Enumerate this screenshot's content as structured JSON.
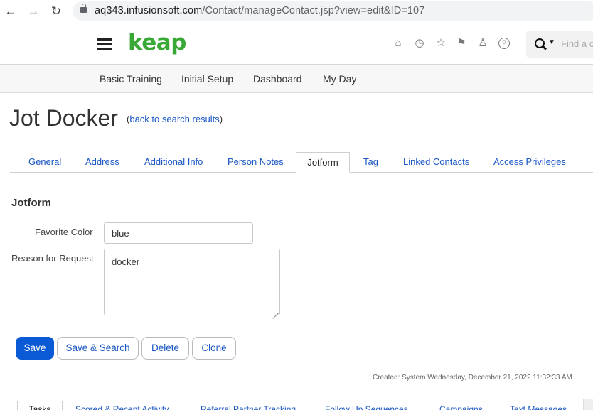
{
  "browser": {
    "back_icon": "←",
    "forward_icon": "→",
    "reload_icon": "↻",
    "url_host": "aq343.infusionsoft.com",
    "url_path": "/Contact/manageContact.jsp?view=edit&ID=107"
  },
  "header": {
    "logo_text": "keap",
    "logo_color": "#39a935",
    "icons": [
      "home-icon",
      "history-icon",
      "star-icon",
      "flag-icon",
      "user-icon",
      "help-icon"
    ],
    "icon_glyphs": [
      "⌂",
      "◷",
      "☆",
      "⚑",
      "♙",
      "?"
    ],
    "search_caret": "▼",
    "search_placeholder": "Find a c"
  },
  "sub_nav": {
    "items": [
      "Basic Training",
      "Initial Setup",
      "Dashboard",
      "My Day"
    ]
  },
  "page": {
    "title": "Jot Docker",
    "back_open": "(",
    "back_link": "back to search results",
    "back_close": ")"
  },
  "tabs": {
    "items": [
      "General",
      "Address",
      "Additional Info",
      "Person Notes",
      "Jotform",
      "Tag",
      "Linked Contacts",
      "Access Privileges"
    ],
    "active": "Jotform"
  },
  "form": {
    "section_title": "Jotform",
    "favorite_color_label": "Favorite Color",
    "favorite_color_value": "blue",
    "reason_label": "Reason for Request",
    "reason_value": "docker"
  },
  "buttons": {
    "save": "Save",
    "save_search": "Save & Search",
    "delete": "Delete",
    "clone": "Clone"
  },
  "created_text": "Created:  System Wednesday, December 21, 2022 11:32:33 AM",
  "bottom_tabs": {
    "items": [
      "Tasks",
      "Scored & Recent Activity",
      "Referral Partner Tracking",
      "Follow Up Sequences",
      "Campaigns",
      "Text Messages"
    ]
  },
  "colors": {
    "link": "#1a57c4",
    "primary_button": "#0a5ad6"
  }
}
